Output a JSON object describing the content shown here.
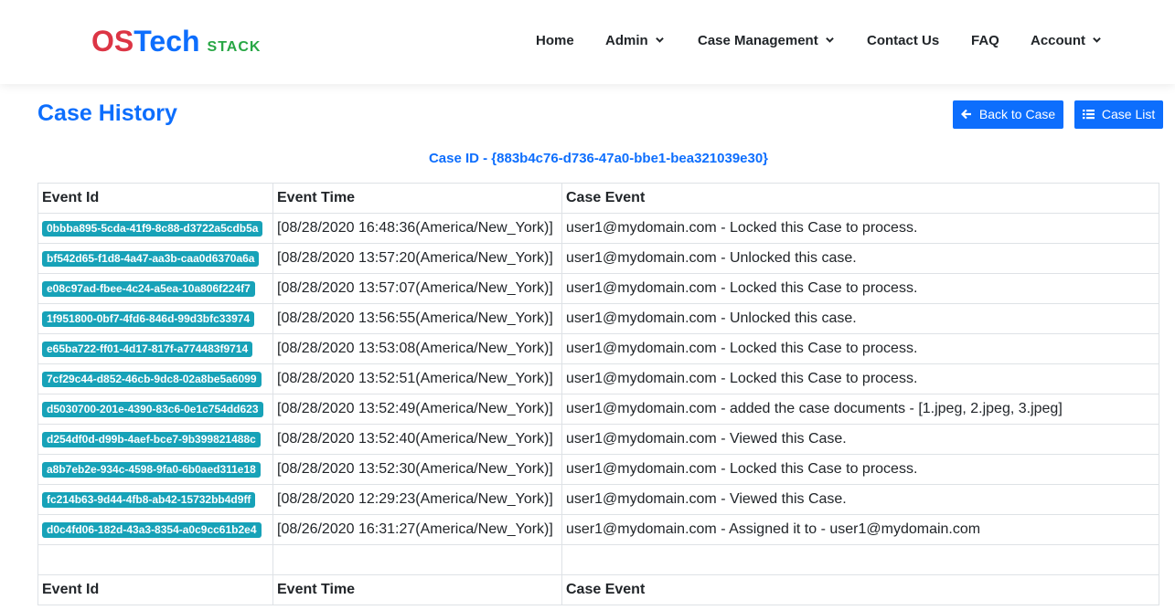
{
  "brand": {
    "part1": "OS",
    "part2": "Tech",
    "suffix": "STACK"
  },
  "nav": [
    {
      "label": "Home",
      "dropdown": false
    },
    {
      "label": "Admin",
      "dropdown": true
    },
    {
      "label": "Case Management",
      "dropdown": true
    },
    {
      "label": "Contact Us",
      "dropdown": false
    },
    {
      "label": "FAQ",
      "dropdown": false
    },
    {
      "label": "Account",
      "dropdown": true
    }
  ],
  "page": {
    "title": "Case History",
    "back_button": "Back to Case",
    "list_button": "Case List",
    "case_id_text": "Case ID - {883b4c76-d736-47a0-bbe1-bea321039e30}"
  },
  "table": {
    "headers": [
      "Event Id",
      "Event Time",
      "Case Event"
    ],
    "rows": [
      {
        "id": "0bbba895-5cda-41f9-8c88-d3722a5cdb5a",
        "time": "[08/28/2020 16:48:36(America/New_York)]",
        "event": "user1@mydomain.com - Locked this Case to process."
      },
      {
        "id": "bf542d65-f1d8-4a47-aa3b-caa0d6370a6a",
        "time": "[08/28/2020 13:57:20(America/New_York)]",
        "event": "user1@mydomain.com - Unlocked this case."
      },
      {
        "id": "e08c97ad-fbee-4c24-a5ea-10a806f224f7",
        "time": "[08/28/2020 13:57:07(America/New_York)]",
        "event": "user1@mydomain.com - Locked this Case to process."
      },
      {
        "id": "1f951800-0bf7-4fd6-846d-99d3bfc33974",
        "time": "[08/28/2020 13:56:55(America/New_York)]",
        "event": "user1@mydomain.com - Unlocked this case."
      },
      {
        "id": "e65ba722-ff01-4d17-817f-a774483f9714",
        "time": "[08/28/2020 13:53:08(America/New_York)]",
        "event": "user1@mydomain.com - Locked this Case to process."
      },
      {
        "id": "7cf29c44-d852-46cb-9dc8-02a8be5a6099",
        "time": "[08/28/2020 13:52:51(America/New_York)]",
        "event": "user1@mydomain.com - Locked this Case to process."
      },
      {
        "id": "d5030700-201e-4390-83c6-0e1c754dd623",
        "time": "[08/28/2020 13:52:49(America/New_York)]",
        "event": "user1@mydomain.com - added the case documents - [1.jpeg, 2.jpeg, 3.jpeg]"
      },
      {
        "id": "d254df0d-d99b-4aef-bce7-9b399821488c",
        "time": "[08/28/2020 13:52:40(America/New_York)]",
        "event": "user1@mydomain.com - Viewed this Case."
      },
      {
        "id": "a8b7eb2e-934c-4598-9fa0-6b0aed311e18",
        "time": "[08/28/2020 13:52:30(America/New_York)]",
        "event": "user1@mydomain.com - Locked this Case to process."
      },
      {
        "id": "fc214b63-9d44-4fb8-ab42-15732bb4d9ff",
        "time": "[08/28/2020 12:29:23(America/New_York)]",
        "event": "user1@mydomain.com - Viewed this Case."
      },
      {
        "id": "d0c4fd06-182d-43a3-8354-a0c9cc61b2e4",
        "time": "[08/26/2020 16:31:27(America/New_York)]",
        "event": "user1@mydomain.com - Assigned it to - user1@mydomain.com"
      }
    ]
  },
  "colors": {
    "primary": "#0d6efd",
    "brand_red": "#dc3545",
    "brand_green": "#28a745",
    "badge": "#17a2b8"
  }
}
